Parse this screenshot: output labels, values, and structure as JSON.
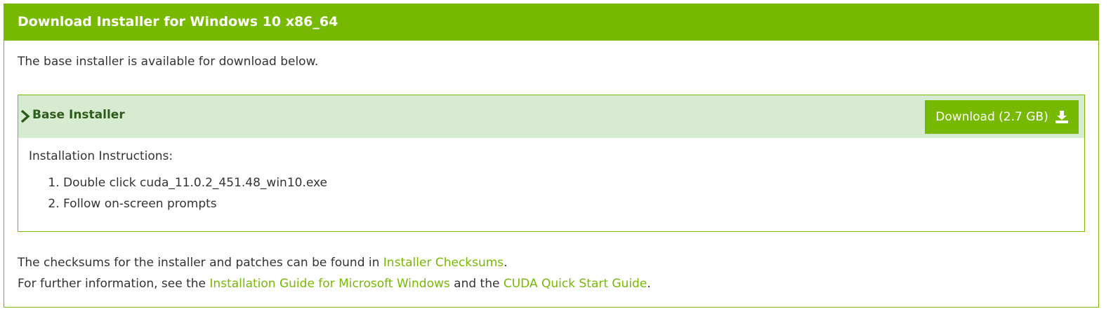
{
  "header": {
    "title": "Download Installer for Windows 10 x86_64"
  },
  "intro": "The base installer is available for download below.",
  "installer": {
    "title": "Base Installer",
    "download_label": "Download (2.7 GB)",
    "instructions_label": "Installation Instructions:",
    "steps": [
      "Double click cuda_11.0.2_451.48_win10.exe",
      "Follow on-screen prompts"
    ]
  },
  "footer": {
    "line1_prefix": "The checksums for the installer and patches can be found in ",
    "line1_link": "Installer Checksums",
    "line1_suffix": ".",
    "line2_prefix": "For further information, see the ",
    "line2_link1": "Installation Guide for Microsoft Windows",
    "line2_middle": " and the ",
    "line2_link2": "CUDA Quick Start Guide",
    "line2_suffix": "."
  },
  "colors": {
    "accent": "#76b900",
    "installer_head_bg": "#d6ebd0",
    "installer_title": "#2e5a1c",
    "text": "#333333"
  },
  "icons": {
    "expand": "chevron-right-icon",
    "download": "download-icon"
  }
}
